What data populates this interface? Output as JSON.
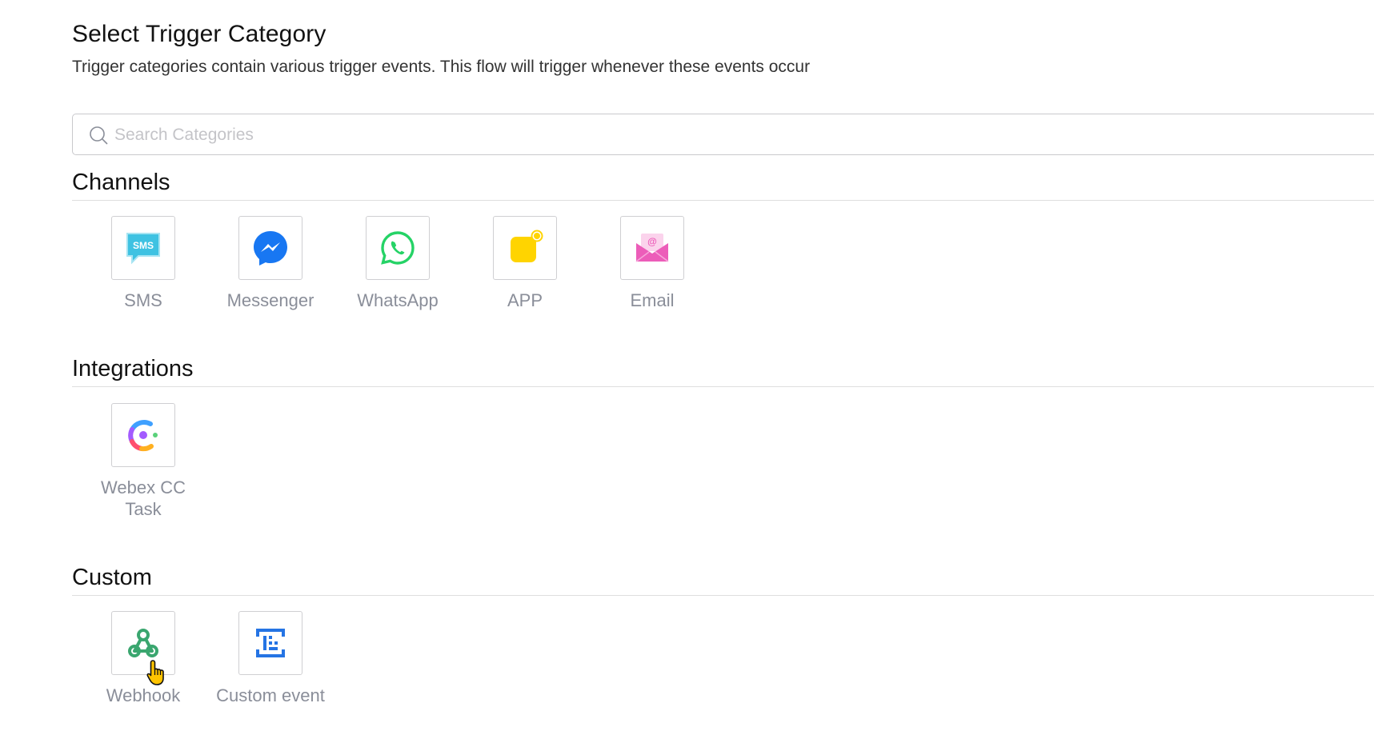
{
  "header": {
    "title": "Select Trigger Category",
    "subtitle": "Trigger categories contain various trigger events. This flow will trigger whenever these events occur"
  },
  "search": {
    "placeholder": "Search Categories",
    "value": "",
    "icon": "search-icon"
  },
  "sections": [
    {
      "title": "Channels",
      "items": [
        {
          "label": "SMS",
          "icon": "sms-icon",
          "color": "#3fc2e2"
        },
        {
          "label": "Messenger",
          "icon": "messenger-icon",
          "color": "#1877f2"
        },
        {
          "label": "WhatsApp",
          "icon": "whatsapp-icon",
          "color": "#25d366"
        },
        {
          "label": "APP",
          "icon": "app-icon",
          "color": "#ffd400"
        },
        {
          "label": "Email",
          "icon": "email-icon",
          "color": "#ec5db9"
        }
      ]
    },
    {
      "title": "Integrations",
      "items": [
        {
          "label": "Webex CC Task",
          "icon": "webex-cc-icon",
          "color": "#7b5cff"
        }
      ]
    },
    {
      "title": "Custom",
      "items": [
        {
          "label": "Webhook",
          "icon": "webhook-icon",
          "color": "#3aa66f"
        },
        {
          "label": "Custom event",
          "icon": "custom-event-icon",
          "color": "#2574e4"
        }
      ]
    }
  ]
}
